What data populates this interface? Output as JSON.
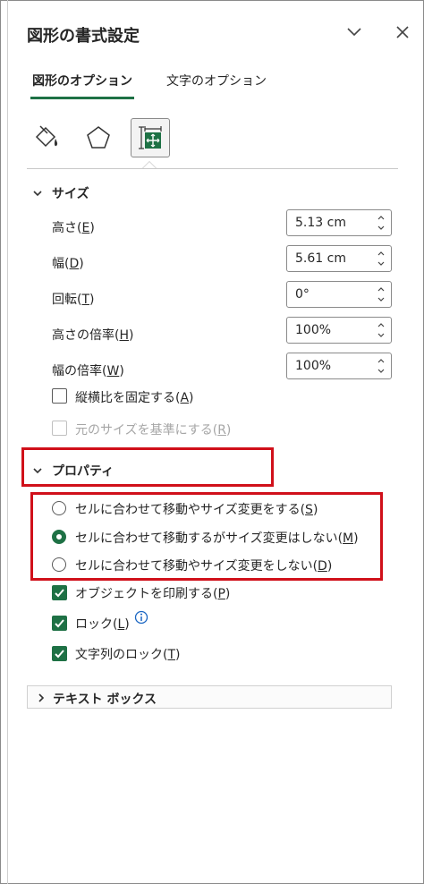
{
  "panel": {
    "title": "図形の書式設定",
    "collapse_icon": "chevron-down-icon",
    "close_icon": "close-icon"
  },
  "tabs": [
    {
      "label": "図形のオプション",
      "active": true
    },
    {
      "label": "文字のオプション",
      "active": false
    }
  ],
  "categories": [
    {
      "icon": "paint-bucket-icon",
      "selected": false
    },
    {
      "icon": "pentagon-icon",
      "selected": false
    },
    {
      "icon": "size-properties-icon",
      "selected": true
    }
  ],
  "size": {
    "header": "サイズ",
    "fields": [
      {
        "label": "高さ(",
        "key": "E",
        "suffix": ")",
        "value": "5.13 cm"
      },
      {
        "label": "幅(",
        "key": "D",
        "suffix": ")",
        "value": "5.61 cm"
      },
      {
        "label": "回転(",
        "key": "T",
        "suffix": ")",
        "value": "0°"
      },
      {
        "label": "高さの倍率(",
        "key": "H",
        "suffix": ")",
        "value": "100%"
      },
      {
        "label": "幅の倍率(",
        "key": "W",
        "suffix": ")",
        "value": "100%"
      }
    ],
    "lock_aspect": {
      "label": "縦横比を固定する(",
      "key": "A",
      "suffix": ")",
      "checked": false
    },
    "relative_original": {
      "label": "元のサイズを基準にする(",
      "key": "R",
      "suffix": ")",
      "checked": false,
      "disabled": true
    }
  },
  "properties": {
    "header": "プロパティ",
    "radios": [
      {
        "label": "セルに合わせて移動やサイズ変更をする(",
        "key": "S",
        "suffix": ")",
        "selected": false
      },
      {
        "label": "セルに合わせて移動するがサイズ変更はしない(",
        "key": "M",
        "suffix": ")",
        "selected": true
      },
      {
        "label": "セルに合わせて移動やサイズ変更をしない(",
        "key": "D",
        "suffix": ")",
        "selected": false
      }
    ],
    "checkboxes": [
      {
        "label": "オブジェクトを印刷する(",
        "key": "P",
        "suffix": ")",
        "checked": true
      },
      {
        "label": "ロック(",
        "key": "L",
        "suffix": ")",
        "checked": true
      },
      {
        "label": "文字列のロック(",
        "key": "T",
        "suffix": ")",
        "checked": true
      }
    ],
    "info_icon": "info-icon"
  },
  "textbox": {
    "header": "テキスト ボックス"
  },
  "colors": {
    "accent": "#1e7145",
    "highlight": "#d0101a"
  }
}
